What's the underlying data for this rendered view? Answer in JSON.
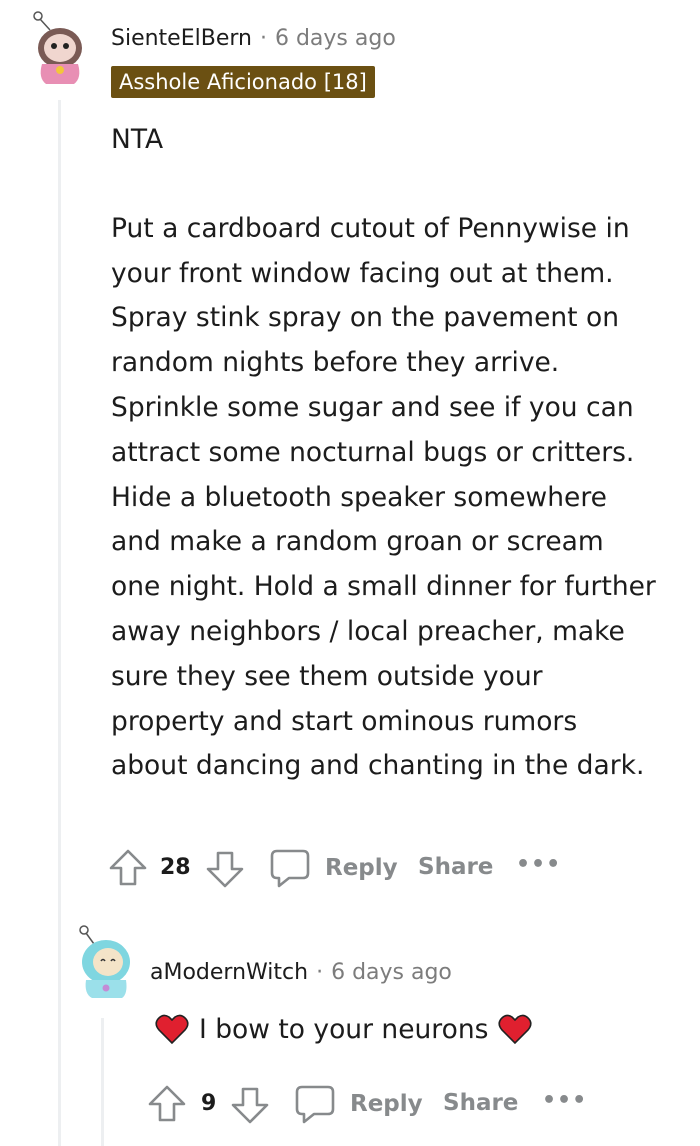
{
  "comment": {
    "username": "SienteElBern",
    "separator": "·",
    "time": "6 days ago",
    "flair": "Asshole Aficionado [18]",
    "paragraphs": [
      "NTA",
      "Put a cardboard cutout of Pennywise in your front window facing out at them. Spray stink spray on the pavement on random nights before they arrive. Sprinkle some sugar and see if you can attract some nocturnal bugs or critters. Hide a bluetooth speaker somewhere and make a random groan or scream one night. Hold a small dinner for further away neighbors / local preacher, make sure they see them outside your property and start ominous rumors about dancing and chanting in the dark."
    ],
    "actions": {
      "votes": "28",
      "reply": "Reply",
      "share": "Share",
      "more": "•••"
    }
  },
  "reply": {
    "username": "aModernWitch",
    "separator": "·",
    "time": "6 days ago",
    "body": "I bow to your neurons",
    "actions": {
      "votes": "9",
      "reply": "Reply",
      "share": "Share",
      "more": "•••"
    }
  },
  "colors": {
    "flair_bg": "#6b5012",
    "heart": "#e0202f",
    "muted": "#878a8c",
    "thread_line": "#edeff1"
  },
  "icons": [
    "upvote-icon",
    "downvote-icon",
    "reply-bubble-icon",
    "heart-emoji-icon"
  ]
}
